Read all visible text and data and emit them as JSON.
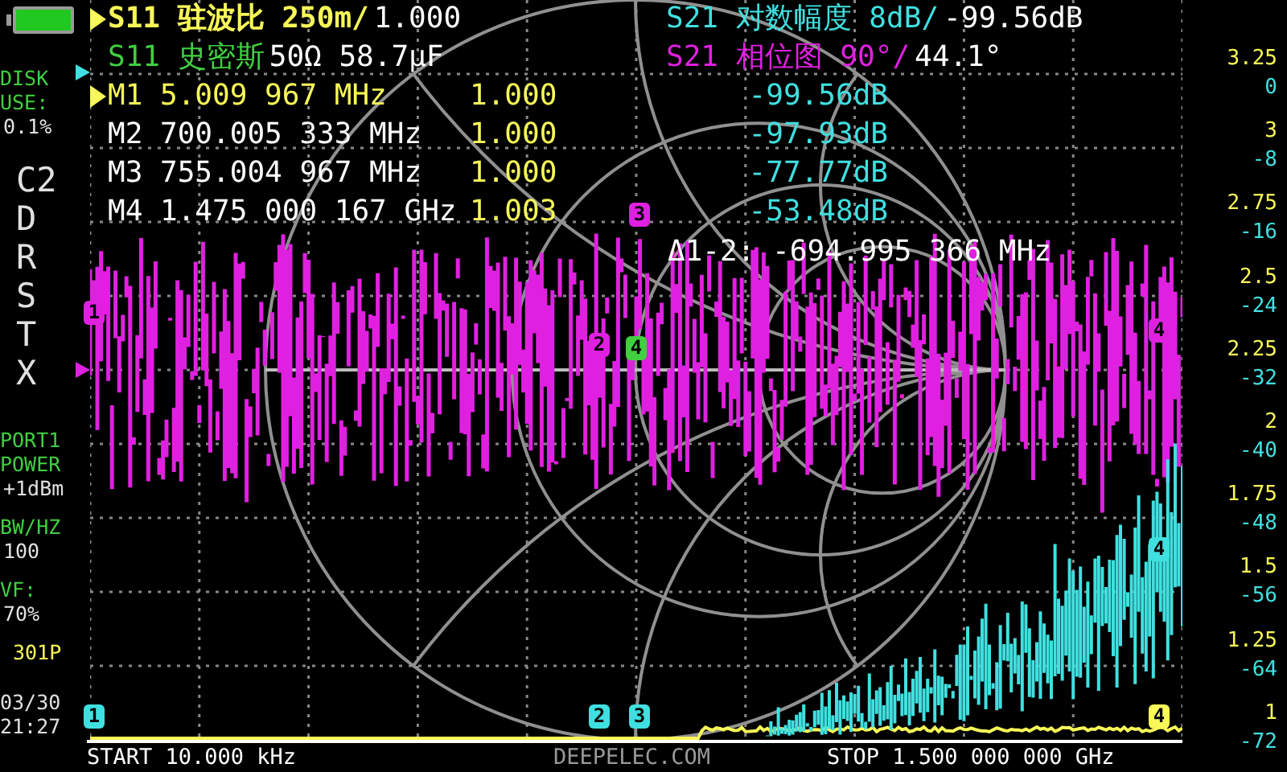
{
  "sidebar": {
    "disk": {
      "label": "DISK USE:",
      "value": "0.1%"
    },
    "calibration": [
      "C2",
      "D",
      "R",
      "S",
      "T",
      "X"
    ],
    "port_power": {
      "label": "PORT1 POWER",
      "value": "+1dBm"
    },
    "bandwidth": {
      "label": "BW/HZ",
      "value": "100"
    },
    "velocity_factor": {
      "label": "VF:",
      "value": "70%"
    },
    "points": "301P",
    "date": "03/30",
    "time": "21:27"
  },
  "traces": [
    {
      "label": "S11 驻波比 250m/",
      "value": "1.000",
      "color": "#f8f858",
      "selected": true
    },
    {
      "label": "S21 对数幅度 8dB/",
      "value": "-99.56dB",
      "color": "#40e0e0",
      "selected": false
    },
    {
      "label": "S11 史密斯",
      "value": "50Ω 58.7μF",
      "color": "#40d040",
      "selected": false
    },
    {
      "label": "S21 相位图 90°/",
      "value": "44.1°",
      "color": "#e020e0",
      "selected": false
    }
  ],
  "markers": [
    {
      "name": "M1",
      "frequency": "5.009 967 MHz",
      "swr": "1.000",
      "logmag": "-99.56dB",
      "selected": true
    },
    {
      "name": "M2",
      "frequency": "700.005 333 MHz",
      "swr": "1.000",
      "logmag": "-97.93dB",
      "selected": false
    },
    {
      "name": "M3",
      "frequency": "755.004 967 MHz",
      "swr": "1.000",
      "logmag": "-77.77dB",
      "selected": false
    },
    {
      "name": "M4",
      "frequency": "1.475 000 167 GHz",
      "swr": "1.003",
      "logmag": "-53.48dB",
      "selected": false
    }
  ],
  "delta": "Δ1-2: -694.995 366 MHz",
  "plot_markers": [
    {
      "label": "3",
      "color": "#e020e0"
    },
    {
      "label": "1",
      "color": "#e020e0"
    },
    {
      "label": "4",
      "color": "#e020e0"
    },
    {
      "label": "2",
      "color": "#e020e0"
    },
    {
      "label": "4",
      "color": "#40d040"
    },
    {
      "label": "4",
      "color": "#40e0e0"
    },
    {
      "label": "1",
      "color": "#40e0e0"
    },
    {
      "label": "2",
      "color": "#40e0e0"
    },
    {
      "label": "3",
      "color": "#40e0e0"
    },
    {
      "label": "4",
      "color": "#f8f858"
    }
  ],
  "axis": {
    "swr_ticks": [
      "3.25",
      "3",
      "2.75",
      "2.5",
      "2.25",
      "2",
      "1.75",
      "1.5",
      "1.25",
      "1"
    ],
    "logmag_ticks": [
      "0",
      "-8",
      "-16",
      "-24",
      "-32",
      "-40",
      "-48",
      "-56",
      "-64",
      "-72"
    ]
  },
  "footer": {
    "start": "START 10.000 kHz",
    "brand": "DEEPELEC.COM",
    "stop": "STOP 1.500 000 000 GHz"
  }
}
